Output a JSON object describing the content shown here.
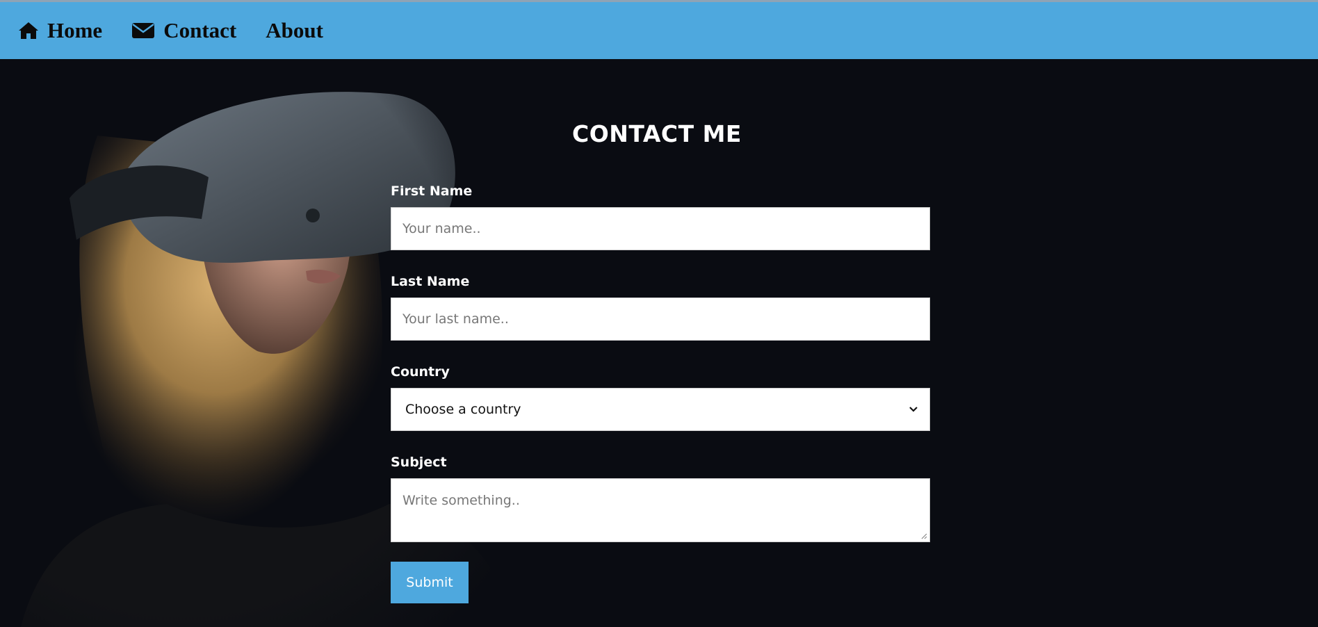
{
  "nav": {
    "items": [
      {
        "label": "Home",
        "icon": "home-icon"
      },
      {
        "label": "Contact",
        "icon": "envelope-icon"
      },
      {
        "label": "About",
        "icon": ""
      }
    ]
  },
  "form": {
    "title": "CONTACT ME",
    "first_name": {
      "label": "First Name",
      "placeholder": "Your name.."
    },
    "last_name": {
      "label": "Last Name",
      "placeholder": "Your last name.."
    },
    "country": {
      "label": "Country",
      "selected": "Choose a country"
    },
    "subject": {
      "label": "Subject",
      "placeholder": "Write something.."
    },
    "submit_label": "Submit"
  },
  "colors": {
    "nav_bg": "#4ea8de",
    "page_bg": "#0a0c12",
    "button_bg": "#4ea8de"
  }
}
